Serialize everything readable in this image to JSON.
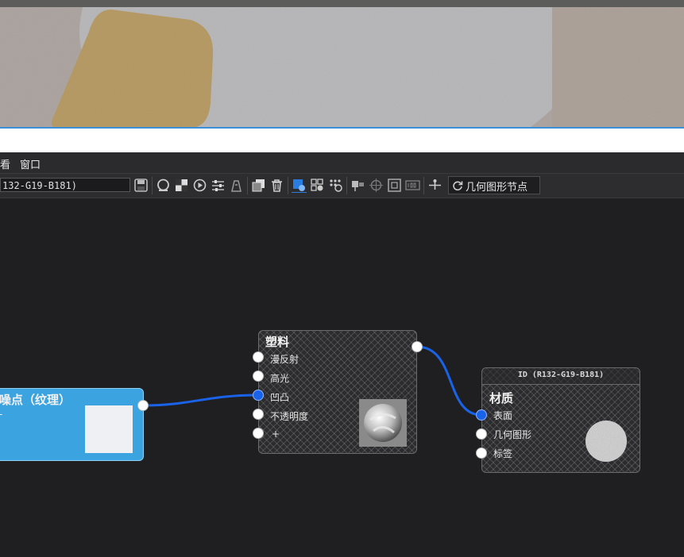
{
  "menubar": {
    "view_label": "看",
    "window_label": "窗口"
  },
  "toolbar": {
    "name_field_value": "132-G19-B181)",
    "geometry_nodes_label": "几何图形节点",
    "accent_color": "#3a8fd8"
  },
  "nodes": {
    "noise": {
      "title": "噪点（纹理）",
      "sub_label": "-"
    },
    "plastic": {
      "title": "塑料",
      "ports": [
        "漫反射",
        "高光",
        "凹凸",
        "不透明度",
        "+"
      ]
    },
    "material": {
      "header": "ID (R132-G19-B181)",
      "title": "材质",
      "ports": [
        "表面",
        "几何图形",
        "标签"
      ]
    }
  },
  "colors": {
    "link": "#1a63e8",
    "noise_node": "#3aa3e0",
    "canvas_bg": "#1f1f21"
  }
}
